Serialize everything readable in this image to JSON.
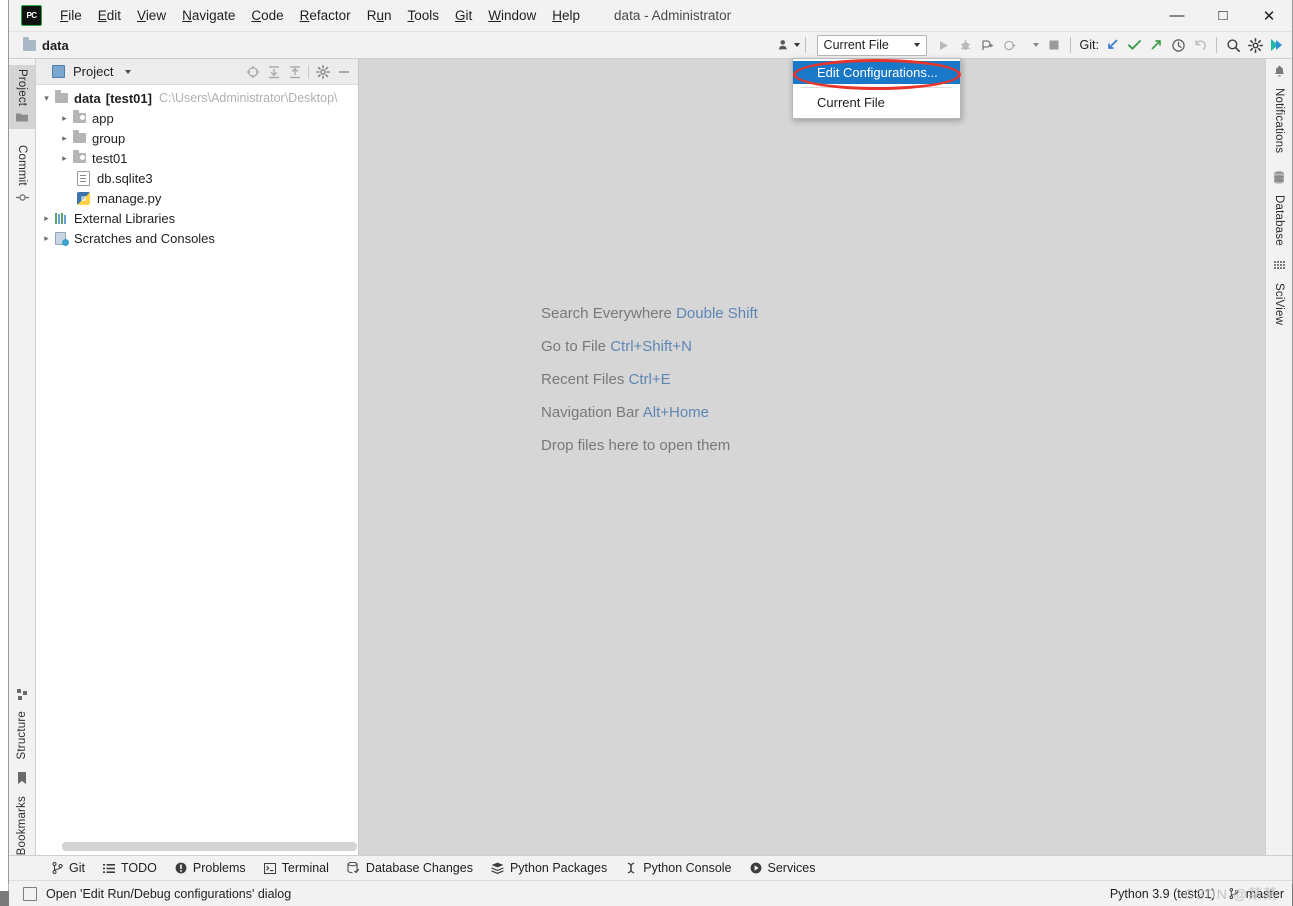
{
  "window": {
    "title": "data - Administrator",
    "logo_text": "PC",
    "controls": {
      "minimize": "—",
      "maximize": "□",
      "close": "✕"
    }
  },
  "menubar": {
    "items": [
      {
        "label": "File",
        "mnemonic": "F"
      },
      {
        "label": "Edit",
        "mnemonic": "E"
      },
      {
        "label": "View",
        "mnemonic": "V"
      },
      {
        "label": "Navigate",
        "mnemonic": "N"
      },
      {
        "label": "Code",
        "mnemonic": "C"
      },
      {
        "label": "Refactor",
        "mnemonic": "R"
      },
      {
        "label": "Run",
        "mnemonic": "u"
      },
      {
        "label": "Tools",
        "mnemonic": "T"
      },
      {
        "label": "Git",
        "mnemonic": "G"
      },
      {
        "label": "Window",
        "mnemonic": "W"
      },
      {
        "label": "Help",
        "mnemonic": "H"
      }
    ]
  },
  "navbar": {
    "breadcrumb": "data",
    "run_config": {
      "label": "Current File",
      "caret": "chevron-down-icon"
    },
    "git_label": "Git:",
    "icons": {
      "user": "user-icon",
      "run": "run-icon",
      "debug": "debug-icon",
      "coverage": "run-coverage-icon",
      "profile": "profile-icon",
      "more": "chevron-down-icon",
      "stop": "stop-icon",
      "update_project": "git-update-icon",
      "commit": "git-commit-icon",
      "push": "git-push-icon",
      "history": "history-icon",
      "rollback": "rollback-icon",
      "search": "search-icon",
      "settings": "gear-icon",
      "avatar": "pycharm-avatar-icon"
    }
  },
  "run_config_menu": {
    "visible": true,
    "items": [
      {
        "label": "Edit Configurations...",
        "selected": true,
        "annotated": true
      },
      {
        "label": "Current File",
        "selected": false,
        "annotated": false
      }
    ],
    "annotation_color": "#e8342a",
    "highlight_color": "#1a78c8"
  },
  "left_rail": {
    "tabs": [
      {
        "label": "Project",
        "icon": "folder-icon",
        "active": true
      },
      {
        "label": "Commit",
        "icon": "commit-icon",
        "active": false
      },
      {
        "label": "Structure",
        "icon": "structure-icon",
        "active": false
      },
      {
        "label": "Bookmarks",
        "icon": "bookmark-icon",
        "active": false
      }
    ]
  },
  "right_rail": {
    "tabs": [
      {
        "label": "Notifications",
        "icon": "bell-icon"
      },
      {
        "label": "Database",
        "icon": "database-icon"
      },
      {
        "label": "SciView",
        "icon": "sciview-icon"
      }
    ]
  },
  "project_panel": {
    "title": "Project",
    "title_caret": "chevron-down-icon",
    "toolbar_icons": [
      {
        "name": "select-opened-file-icon",
        "glyph": "⊕"
      },
      {
        "name": "expand-all-icon",
        "glyph": "↧"
      },
      {
        "name": "collapse-all-icon",
        "glyph": "↥"
      },
      {
        "name": "gear-icon",
        "glyph": "⚙"
      },
      {
        "name": "hide-icon",
        "glyph": "—"
      }
    ],
    "tree": [
      {
        "depth": 0,
        "arrow": "expanded",
        "icon": "folder-icon",
        "label": "data",
        "badge": "[test01]",
        "path": "C:\\Users\\Administrator\\Desktop\\"
      },
      {
        "depth": 1,
        "arrow": "collapsed",
        "icon": "source-folder-icon",
        "label": "app"
      },
      {
        "depth": 1,
        "arrow": "collapsed",
        "icon": "folder-icon",
        "label": "group"
      },
      {
        "depth": 1,
        "arrow": "collapsed",
        "icon": "source-folder-icon",
        "label": "test01"
      },
      {
        "depth": 2,
        "arrow": "none",
        "icon": "sqlite-file-icon",
        "label": "db.sqlite3"
      },
      {
        "depth": 2,
        "arrow": "none",
        "icon": "python-file-icon",
        "label": "manage.py"
      },
      {
        "depth": 0,
        "arrow": "collapsed",
        "icon": "libraries-icon",
        "label": "External Libraries"
      },
      {
        "depth": 0,
        "arrow": "collapsed",
        "icon": "scratches-icon",
        "label": "Scratches and Consoles"
      }
    ]
  },
  "editor": {
    "hints": [
      {
        "text": "Search Everywhere",
        "key": "Double Shift"
      },
      {
        "text": "Go to File",
        "key": "Ctrl+Shift+N"
      },
      {
        "text": "Recent Files",
        "key": "Ctrl+E"
      },
      {
        "text": "Navigation Bar",
        "key": "Alt+Home"
      },
      {
        "text": "Drop files here to open them",
        "key": ""
      }
    ]
  },
  "tool_windows": {
    "buttons": [
      {
        "label": "Git",
        "icon": "git-branch-icon"
      },
      {
        "label": "TODO",
        "icon": "todo-list-icon"
      },
      {
        "label": "Problems",
        "icon": "problems-icon"
      },
      {
        "label": "Terminal",
        "icon": "terminal-icon"
      },
      {
        "label": "Database Changes",
        "icon": "database-changes-icon"
      },
      {
        "label": "Python Packages",
        "icon": "python-packages-icon"
      },
      {
        "label": "Python Console",
        "icon": "python-console-icon"
      },
      {
        "label": "Services",
        "icon": "services-icon"
      }
    ]
  },
  "status_bar": {
    "message": "Open 'Edit Run/Debug configurations' dialog",
    "message_icon": "dialog-icon",
    "interpreter": "Python 3.9 (test01)",
    "branch": "master",
    "branch_icon": "git-branch-icon",
    "watermark": "CSDN @某某"
  }
}
